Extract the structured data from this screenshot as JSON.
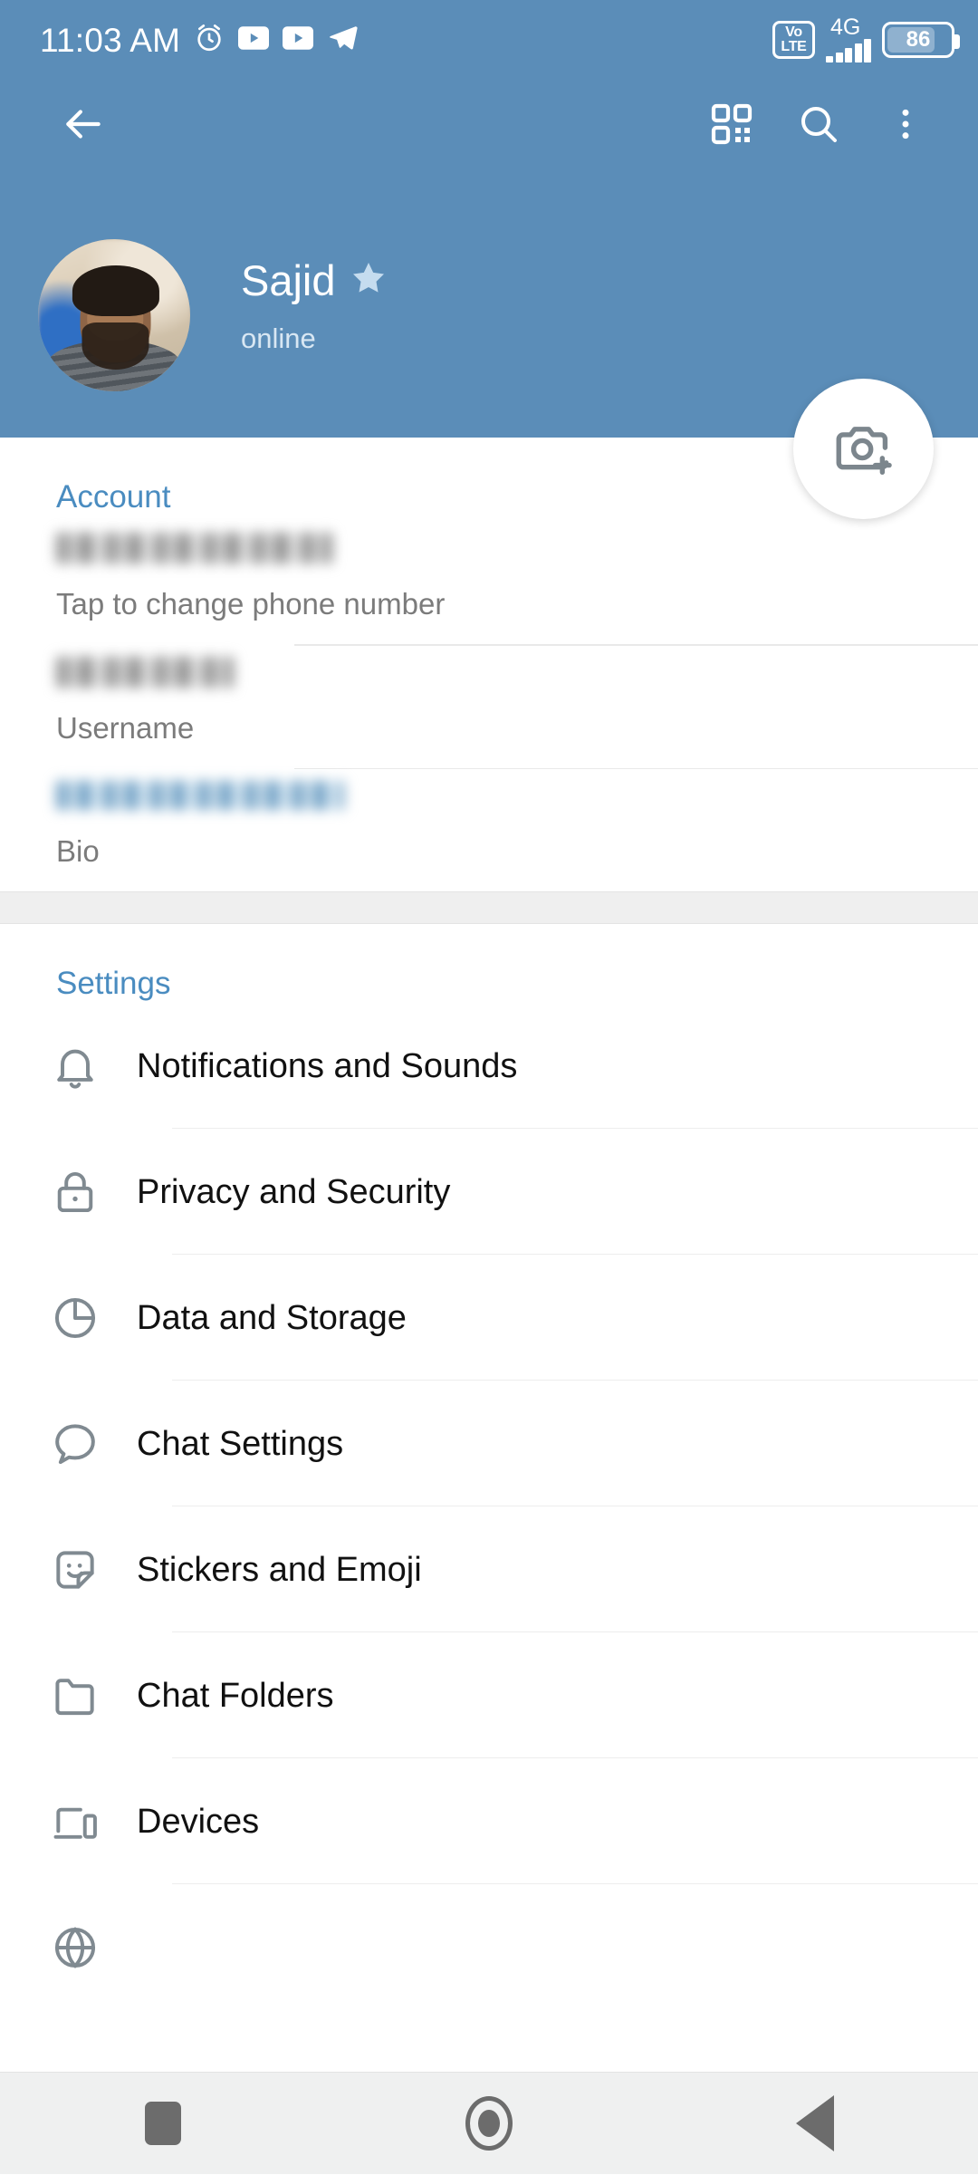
{
  "status_bar": {
    "time": "11:03 AM",
    "left_icons": [
      "alarm-icon",
      "youtube-icon",
      "youtube-icon",
      "telegram-icon"
    ],
    "volte_line1": "Vo",
    "volte_line2": "LTE",
    "network": "4G",
    "signal_bars": 4,
    "battery_percent": "86"
  },
  "app_bar": {
    "back_label": "back-arrow-icon",
    "qr_label": "qr-code-icon",
    "search_label": "search-icon",
    "menu_label": "more-options-icon"
  },
  "profile": {
    "name": "Sajid",
    "status": "online",
    "badge": "premium-star-icon",
    "avatar_alt": "profile-photo",
    "camera_button": "add-photo-icon"
  },
  "colors": {
    "header_blue": "#5B8DB8",
    "accent_blue": "#4A8CC0",
    "star_blue": "#C5DCEF",
    "status_text": "#D8E7F3",
    "icon_gray": "#808A91",
    "label_gray": "#7B7B7B",
    "divider": "#EDEDED",
    "gap_gray": "#EFEFEF",
    "nav_gray": "#6C6C6C",
    "nav_bg": "#EFF0F0"
  },
  "account": {
    "title": "Account",
    "rows": [
      {
        "value": "",
        "value_state": "blurred",
        "value_style": "gray",
        "label": "Tap to change phone number"
      },
      {
        "value": "",
        "value_state": "blurred",
        "value_style": "gray",
        "label": "Username"
      },
      {
        "value": "",
        "value_state": "blurred",
        "value_style": "blue",
        "label": "Bio"
      }
    ]
  },
  "settings": {
    "title": "Settings",
    "rows": [
      {
        "icon": "bell-icon",
        "label": "Notifications and Sounds"
      },
      {
        "icon": "lock-icon",
        "label": "Privacy and Security"
      },
      {
        "icon": "pie-chart-icon",
        "label": "Data and Storage"
      },
      {
        "icon": "chat-bubble-icon",
        "label": "Chat Settings"
      },
      {
        "icon": "sticker-icon",
        "label": "Stickers and Emoji"
      },
      {
        "icon": "folder-icon",
        "label": "Chat Folders"
      },
      {
        "icon": "devices-icon",
        "label": "Devices"
      },
      {
        "icon": "globe-icon",
        "label": ""
      }
    ]
  },
  "nav_bar": {
    "recents": "recents-square-icon",
    "home": "home-circle-icon",
    "back": "back-triangle-icon"
  }
}
